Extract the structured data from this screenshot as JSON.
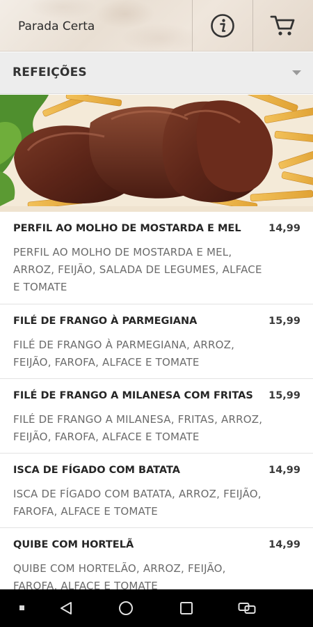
{
  "header": {
    "brand": "Parada Certa",
    "info_icon": "info-circle-icon",
    "cart_icon": "shopping-cart-icon"
  },
  "category": {
    "selected": "REFEIÇÕES",
    "dropdown_icon": "triangle-down-icon"
  },
  "banner": {
    "image": "grilled-beef-with-fries-photo"
  },
  "menu_items": [
    {
      "title": "PERFIL AO MOLHO DE MOSTARDA E MEL",
      "price": "14,99",
      "description": "PERFIL AO MOLHO DE MOSTARDA E MEL, ARROZ, FEIJÃO, SALADA DE LEGUMES, ALFACE E TOMATE"
    },
    {
      "title": "FILÉ DE FRANGO À PARMEGIANA",
      "price": "15,99",
      "description": "FILÉ DE FRANGO À PARMEGIANA, ARROZ, FEIJÃO, FAROFA, ALFACE E TOMATE"
    },
    {
      "title": "FILÉ DE FRANGO A MILANESA COM FRITAS",
      "price": "15,99",
      "description": "FILÉ DE FRANGO A MILANESA, FRITAS, ARROZ, FEIJÃO, FAROFA, ALFACE E TOMATE"
    },
    {
      "title": "ISCA DE FÍGADO COM BATATA",
      "price": "14,99",
      "description": "ISCA DE FÍGADO COM BATATA, ARROZ, FEIJÃO, FAROFA, ALFACE E TOMATE"
    },
    {
      "title": "QUIBE COM HORTELÃ",
      "price": "14,99",
      "description": "QUIBE COM HORTELÃO, ARROZ, FEIJÃO, FAROFA, ALFACE E TOMATE"
    }
  ],
  "navbar": {
    "icons": [
      "dot-icon",
      "back-icon",
      "home-icon",
      "recents-icon",
      "screen-mirror-icon"
    ]
  },
  "colors": {
    "header_bg": "#ede4da",
    "category_bg": "#ededed",
    "navbar_bg": "#000000",
    "title_text": "#262626",
    "desc_text": "#6b6b6b"
  }
}
